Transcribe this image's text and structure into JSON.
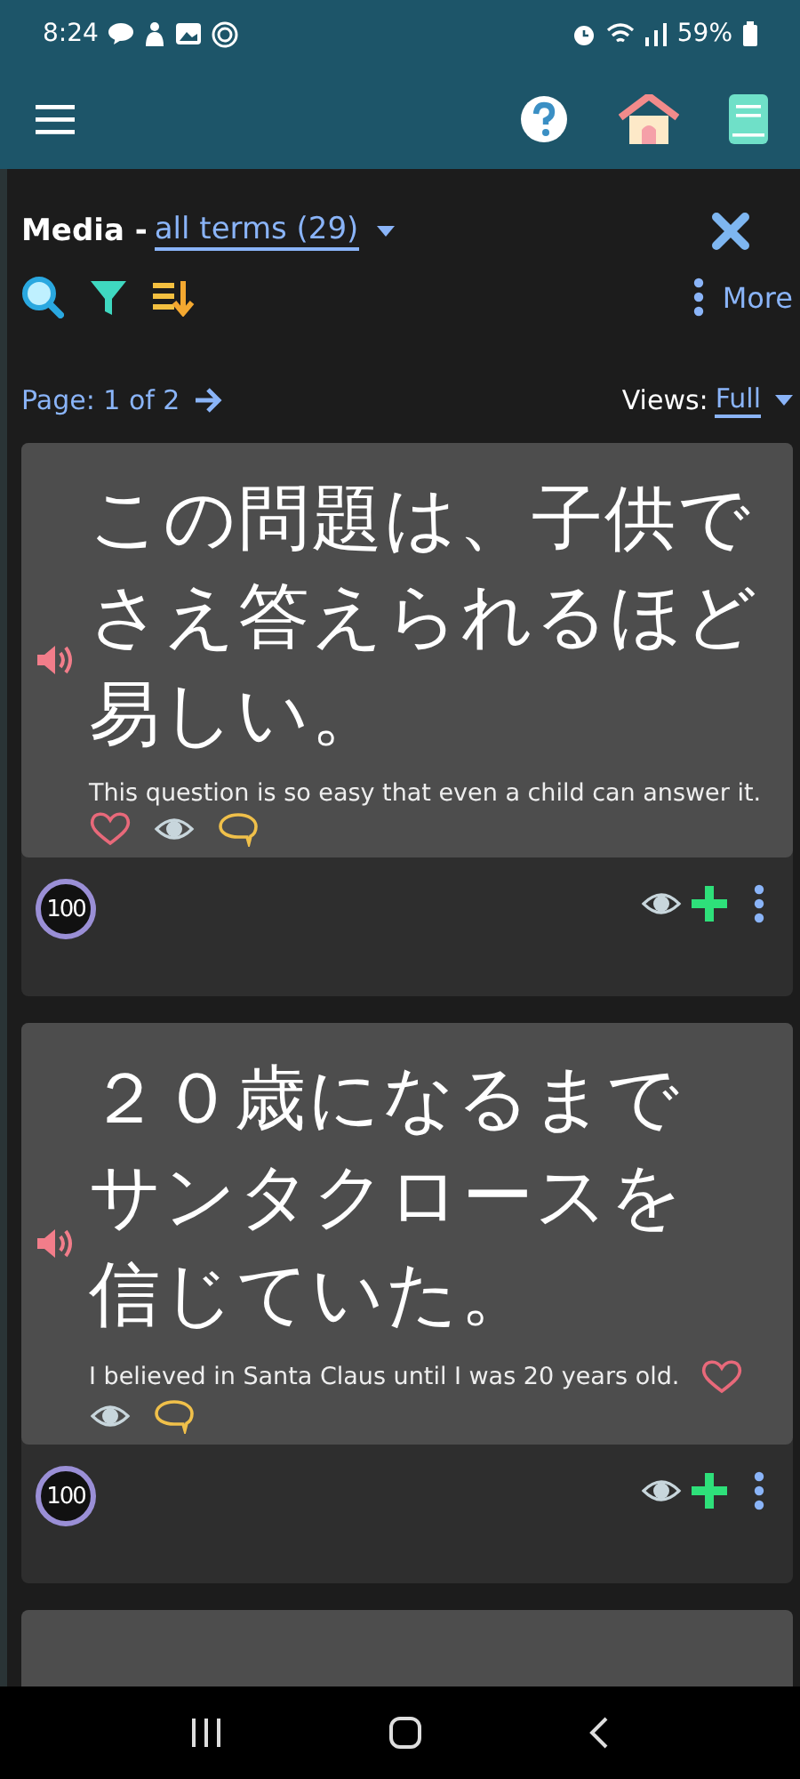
{
  "status_bar": {
    "time": "8:24",
    "battery": "59%"
  },
  "header": {
    "title": "Media -",
    "filter": "all terms (29)",
    "more": "More"
  },
  "pager": {
    "page": "Page: 1 of 2",
    "views_label": "Views:",
    "views_value": "Full"
  },
  "cards": [
    {
      "lines": [
        "この問題は、子供で",
        "さえ答えられるほど",
        "易しい。"
      ],
      "translation": "This question is so easy that even a child can answer it.",
      "score": "100"
    },
    {
      "lines": [
        "２０歳になるまで",
        "サンタクロースを",
        "信じていた。"
      ],
      "translation": "I believed in Santa Claus until I was 20 years old.",
      "score": "100"
    }
  ],
  "partial_card": {
    "kind": "card"
  }
}
